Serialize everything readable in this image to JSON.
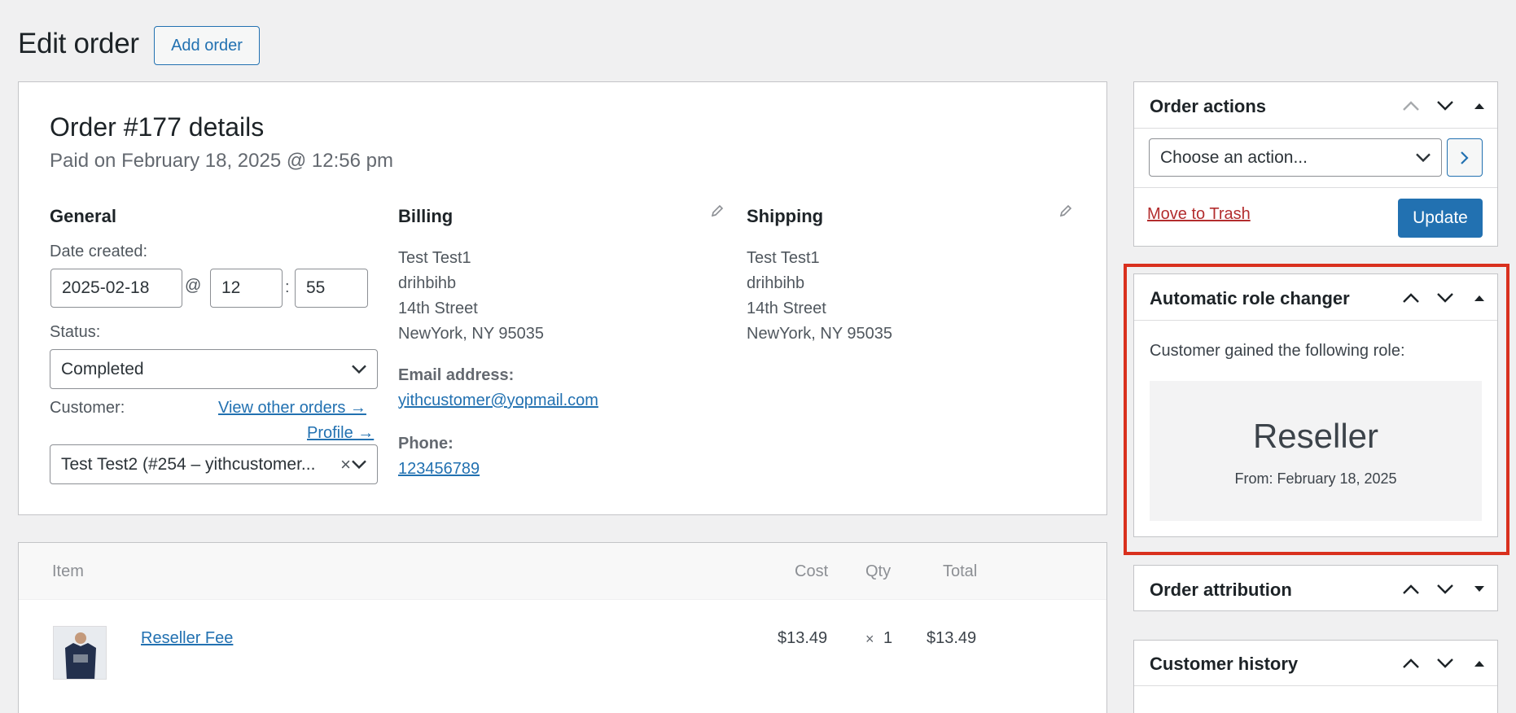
{
  "header": {
    "title": "Edit order",
    "add_order_label": "Add order"
  },
  "order": {
    "heading": "Order #177 details",
    "paid_on": "Paid on February 18, 2025 @ 12:56 pm",
    "general": {
      "title": "General",
      "date_created_label": "Date created:",
      "date_value": "2025-02-18",
      "at_sep": "@",
      "hour_value": "12",
      "colon_sep": ":",
      "minute_value": "55",
      "status_label": "Status:",
      "status_value": "Completed",
      "customer_label": "Customer:",
      "view_other_orders": "View other orders →",
      "profile_link": "Profile →",
      "customer_value": "Test Test2 (#254 – yithcustomer...",
      "clear_glyph": "×"
    },
    "billing": {
      "title": "Billing",
      "address_lines": [
        "Test Test1",
        "drihbihb",
        "14th Street",
        "NewYork, NY 95035"
      ],
      "email_label": "Email address:",
      "email_value": "yithcustomer@yopmail.com",
      "phone_label": "Phone:",
      "phone_value": "123456789"
    },
    "shipping": {
      "title": "Shipping",
      "address_lines": [
        "Test Test1",
        "drihbihb",
        "14th Street",
        "NewYork, NY 95035"
      ]
    }
  },
  "items": {
    "columns": {
      "item": "Item",
      "cost": "Cost",
      "qty": "Qty",
      "total": "Total"
    },
    "rows": [
      {
        "name": "Reseller Fee",
        "cost": "$13.49",
        "qty_sign": "×",
        "qty": "1",
        "total": "$13.49"
      }
    ]
  },
  "sidebar": {
    "order_actions": {
      "title": "Order actions",
      "select_value": "Choose an action...",
      "trash_label": "Move to Trash",
      "update_label": "Update"
    },
    "role_changer": {
      "title": "Automatic role changer",
      "description": "Customer gained the following role:",
      "role": "Reseller",
      "from": "From: February 18, 2025"
    },
    "order_attribution": {
      "title": "Order attribution"
    },
    "customer_history": {
      "title": "Customer history"
    }
  },
  "colors": {
    "accent": "#2271b1",
    "danger": "#b32d2e",
    "highlight": "#d9301e",
    "background": "#f0f0f1"
  }
}
